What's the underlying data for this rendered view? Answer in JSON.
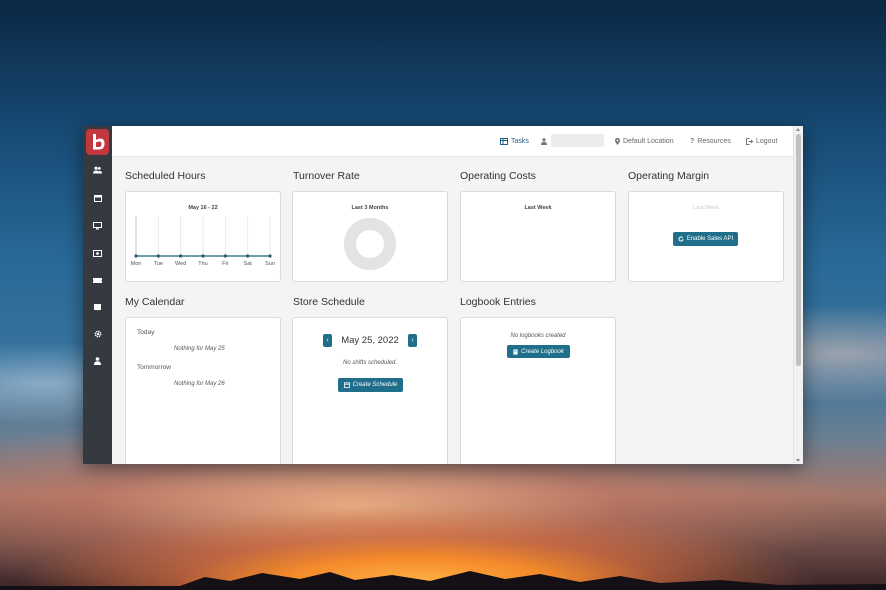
{
  "topbar": {
    "tasks": "Tasks",
    "location": "Default Location",
    "resources": "Resources",
    "logout": "Logout"
  },
  "sidebar": {
    "icons": [
      "users-icon",
      "calendar-icon",
      "monitor-icon",
      "cash-icon",
      "ticket-icon",
      "book-icon",
      "gear-icon",
      "person-icon"
    ]
  },
  "scheduled_hours": {
    "title": "Scheduled Hours",
    "range": "May 16 - 22",
    "days": [
      "Mon",
      "Tue",
      "Wed",
      "Thu",
      "Fri",
      "Sat",
      "Sun"
    ]
  },
  "chart_data": {
    "type": "line",
    "categories": [
      "Mon",
      "Tue",
      "Wed",
      "Thu",
      "Fri",
      "Sat",
      "Sun"
    ],
    "values": [
      0,
      0,
      0,
      0,
      0,
      0,
      0
    ],
    "title": "May 16 - 22",
    "xlabel": "",
    "ylabel": "",
    "grid": true
  },
  "turnover_rate": {
    "title": "Turnover Rate",
    "period": "Last 3 Months"
  },
  "operating_costs": {
    "title": "Operating Costs",
    "period": "Last Week"
  },
  "operating_margin": {
    "title": "Operating Margin",
    "period": "Last Week",
    "button": "Enable Sales API"
  },
  "my_calendar": {
    "title": "My Calendar",
    "today_label": "Today",
    "today_text": "Nothing for May 25",
    "tomorrow_label": "Tommorrow",
    "tomorrow_text": "Nothing for May 26"
  },
  "store_schedule": {
    "title": "Store Schedule",
    "date": "May 25, 2022",
    "empty": "No shifts scheduled.",
    "button": "Create Schedule"
  },
  "logbook": {
    "title": "Logbook Entries",
    "empty": "No logbooks created",
    "button": "Create Logbook"
  },
  "colors": {
    "brand": "#c3383f",
    "accent": "#1f6f8b",
    "sidebar": "#343a3f"
  }
}
